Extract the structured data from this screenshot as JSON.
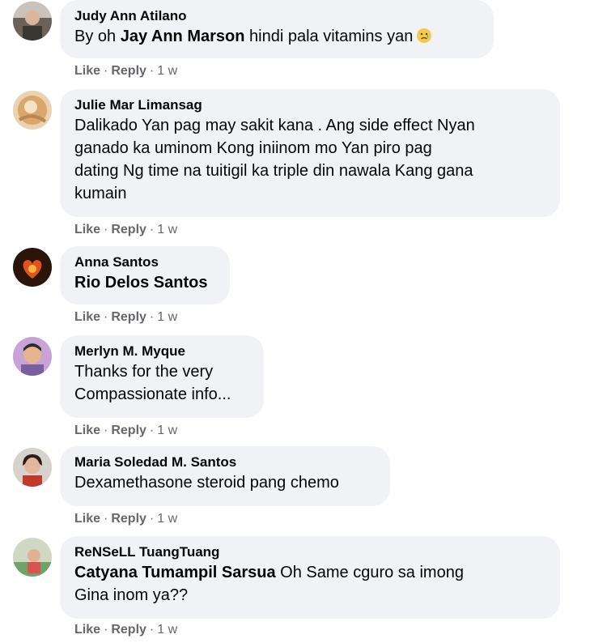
{
  "actions": {
    "like": "Like",
    "reply": "Reply",
    "separator": "·"
  },
  "comments": [
    {
      "author": "Judy Ann Atilano",
      "text_prefix": "By oh ",
      "mention": "Jay Ann Marson",
      "text": " hindi pala vitamins yan",
      "emoji": "sad-face-emoji",
      "time": "1 w"
    },
    {
      "author": "Julie Mar Limansag",
      "lines": [
        "Dalikado Yan pag may sakit kana . Ang side effect Nyan",
        "ganado ka uminom Kong iniinom mo Yan piro pag",
        "dating Ng time na tuitigil ka triple din nawala Kang gana",
        "kumain"
      ],
      "time": "1 w"
    },
    {
      "author": "Anna Santos",
      "mention": "Rio Delos Santos",
      "time": "1 w"
    },
    {
      "author": "Merlyn M. Myque",
      "lines": [
        "Thanks for the very",
        "Compassionate info..."
      ],
      "time": "1 w"
    },
    {
      "author": "Maria Soledad M. Santos",
      "text": "Dexamethasone steroid pang chemo",
      "time": "1 w"
    },
    {
      "author": "ReNSeLL TuangTuang",
      "mention": "Catyana Tumampil Sarsua",
      "text": " Oh Same cguro sa imong",
      "line2": "Gina inom ya??",
      "time": "1 w"
    }
  ],
  "colors": {
    "bubble": "#f0f2f5",
    "meta": "#65676b",
    "text": "#050505"
  }
}
